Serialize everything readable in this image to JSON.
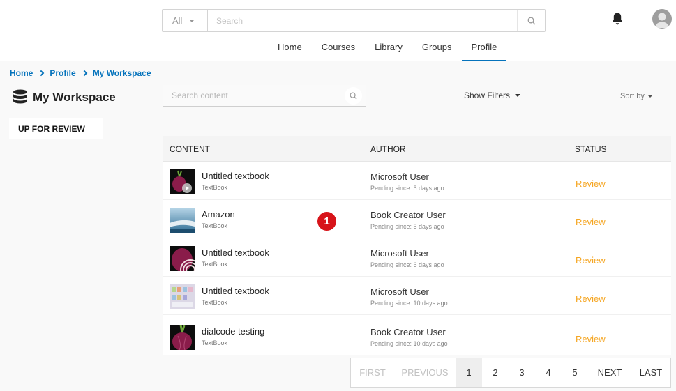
{
  "header": {
    "search_scope": "All",
    "search_placeholder": "Search",
    "nav": [
      "Home",
      "Courses",
      "Library",
      "Groups",
      "Profile"
    ],
    "active_nav": "Profile"
  },
  "breadcrumb": [
    "Home",
    "Profile",
    "My Workspace"
  ],
  "sidebar": {
    "title": "My Workspace",
    "tab": "UP FOR REVIEW"
  },
  "toolbar": {
    "search_placeholder": "Search content",
    "filters_label": "Show Filters",
    "sort_label": "Sort by"
  },
  "table": {
    "columns": [
      "CONTENT",
      "AUTHOR",
      "STATUS"
    ],
    "rows": [
      {
        "title": "Untitled textbook",
        "type": "TextBook",
        "author": "Microsoft User",
        "pending": "Pending since: 5 days ago",
        "status": "Review",
        "thumb": "onion-play"
      },
      {
        "title": "Amazon",
        "type": "TextBook",
        "author": "Book Creator User",
        "pending": "Pending since: 5 days ago",
        "status": "Review",
        "thumb": "river"
      },
      {
        "title": "Untitled textbook",
        "type": "TextBook",
        "author": "Microsoft User",
        "pending": "Pending since: 6 days ago",
        "status": "Review",
        "thumb": "onion-slice"
      },
      {
        "title": "Untitled textbook",
        "type": "TextBook",
        "author": "Microsoft User",
        "pending": "Pending since: 10 days ago",
        "status": "Review",
        "thumb": "collage"
      },
      {
        "title": "dialcode testing",
        "type": "TextBook",
        "author": "Book Creator User",
        "pending": "Pending since: 10 days ago",
        "status": "Review",
        "thumb": "onion"
      }
    ]
  },
  "marker": "1",
  "pagination": {
    "items": [
      "FIRST",
      "PREVIOUS",
      "1",
      "2",
      "3",
      "4",
      "5",
      "NEXT",
      "LAST"
    ],
    "current": "1"
  },
  "colors": {
    "accent": "#0573bc",
    "review": "#f5a623",
    "marker": "#d7141a"
  }
}
